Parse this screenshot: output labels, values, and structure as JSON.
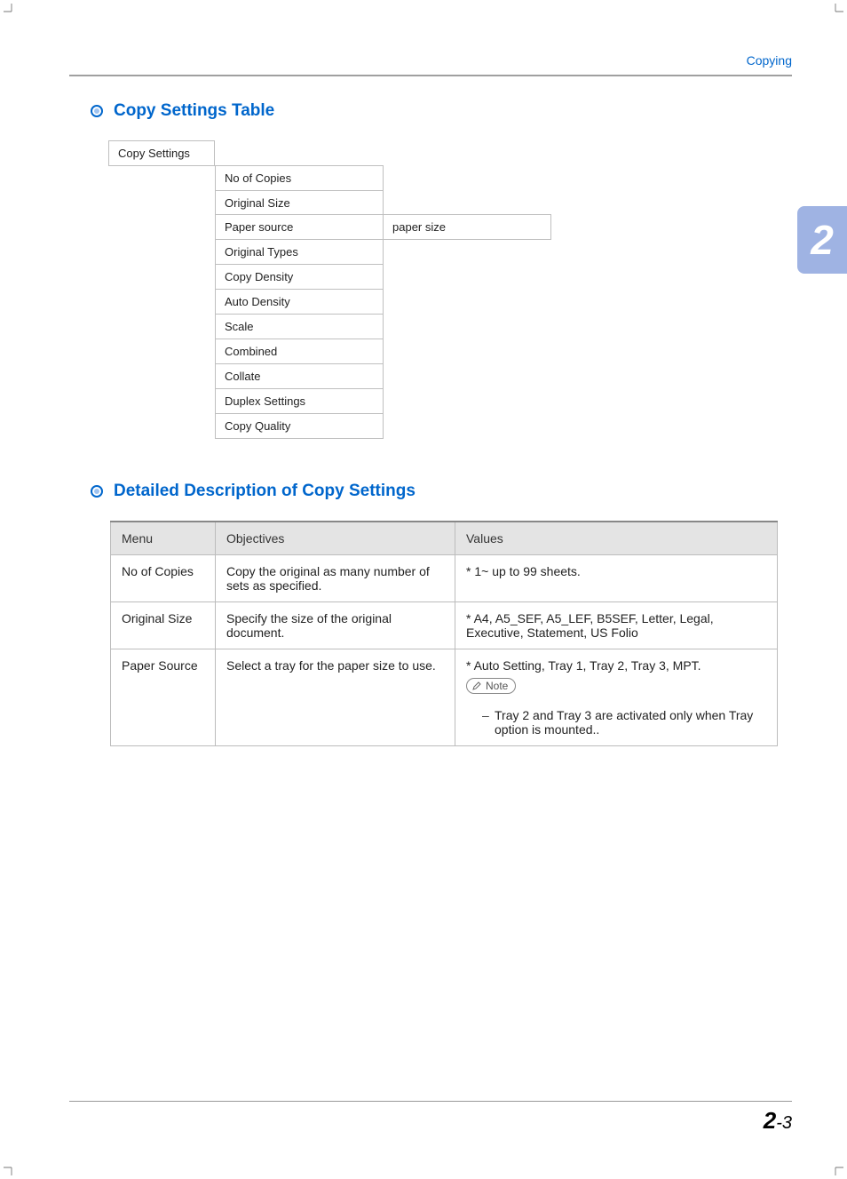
{
  "header": {
    "section": "Copying"
  },
  "chapter_tab": "2",
  "sections": {
    "settings_table": {
      "title": "Copy Settings Table",
      "root": "Copy Settings",
      "items": [
        "No of Copies",
        "Original Size",
        "Paper source",
        "Original Types",
        "Copy Density",
        "Auto Density",
        "Scale",
        "Combined",
        "Collate",
        "Duplex Settings",
        "Copy Quality"
      ],
      "paper_source_child": "paper size"
    },
    "detailed": {
      "title": "Detailed Description of Copy Settings",
      "columns": {
        "menu": "Menu",
        "objectives": "Objectives",
        "values": "Values"
      },
      "rows": [
        {
          "menu": "No of Copies",
          "objectives": "Copy the original as many number of sets as specified.",
          "values": "* 1~ up to 99 sheets."
        },
        {
          "menu": "Original Size",
          "objectives": "Specify the size of the original document.",
          "values": "* A4, A5_SEF, A5_LEF, B5SEF, Letter, Legal, Executive, Statement, US Folio"
        },
        {
          "menu": "Paper Source",
          "objectives": "Select a tray for the paper size to use.",
          "values_main": "* Auto Setting, Tray 1, Tray 2, Tray 3, MPT.",
          "note_label": "Note",
          "note_text": "Tray 2 and Tray 3 are activated only when Tray option is mounted.."
        }
      ]
    }
  },
  "page_number": {
    "chapter": "2",
    "separator": "-",
    "page": "3"
  }
}
